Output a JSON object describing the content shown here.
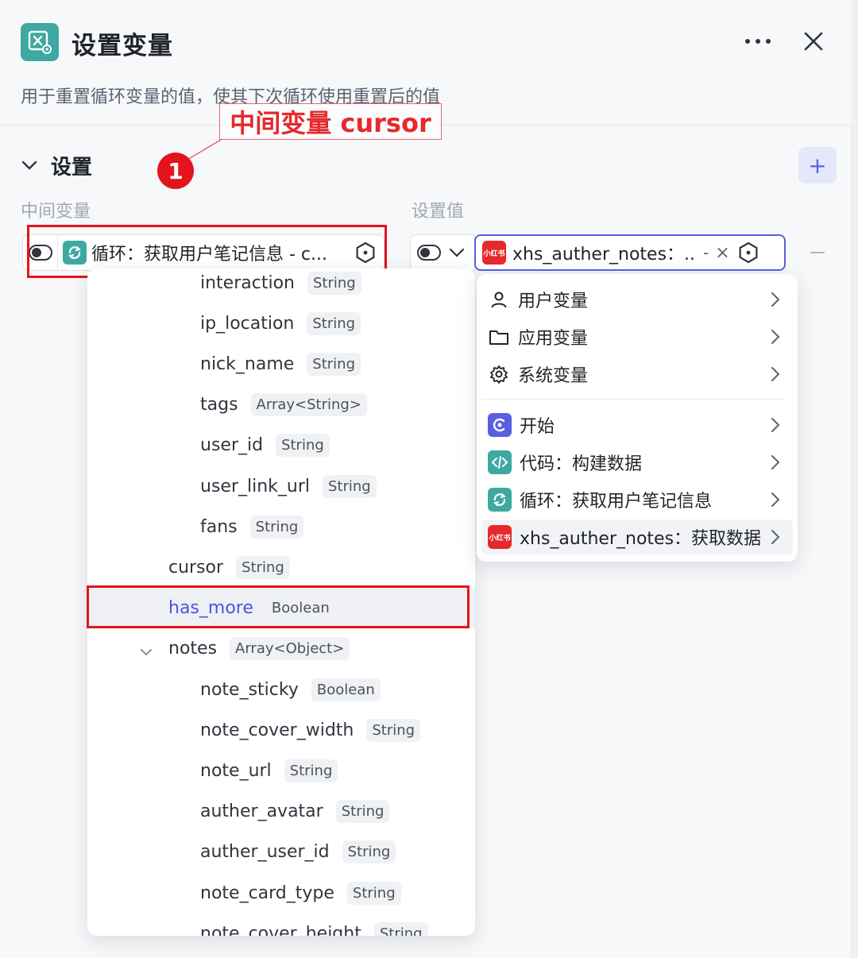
{
  "header": {
    "title": "设置变量",
    "description": "用于重置循环变量的值，使其下次循环使用重置后的值",
    "more_label": "···",
    "close_label": "✕"
  },
  "annotation": {
    "callout": "中间变量 cursor",
    "badge": "1"
  },
  "section": {
    "title": "设置",
    "add_label": "+"
  },
  "columns": {
    "intermediate": "中间变量",
    "set_value": "设置值"
  },
  "left_field": {
    "text": "循环：获取用户笔记信息 - c..."
  },
  "right_field": {
    "source_badge": "小红书",
    "text": "xhs_auther_notes：...",
    "dash": "-",
    "clear": "×"
  },
  "tree": {
    "rows": [
      {
        "name": "interaction",
        "type": "String",
        "indent": 2
      },
      {
        "name": "ip_location",
        "type": "String",
        "indent": 2
      },
      {
        "name": "nick_name",
        "type": "String",
        "indent": 2
      },
      {
        "name": "tags",
        "type": "Array<String>",
        "indent": 2
      },
      {
        "name": "user_id",
        "type": "String",
        "indent": 2
      },
      {
        "name": "user_link_url",
        "type": "String",
        "indent": 2
      },
      {
        "name": "fans",
        "type": "String",
        "indent": 2
      },
      {
        "name": "cursor",
        "type": "String",
        "indent": 1
      },
      {
        "name": "has_more",
        "type": "Boolean",
        "indent": 1,
        "selected": true
      },
      {
        "name": "notes",
        "type": "Array<Object>",
        "indent": 1,
        "expanded": true
      },
      {
        "name": "note_sticky",
        "type": "Boolean",
        "indent": 2
      },
      {
        "name": "note_cover_width",
        "type": "String",
        "indent": 2
      },
      {
        "name": "note_url",
        "type": "String",
        "indent": 2
      },
      {
        "name": "auther_avatar",
        "type": "String",
        "indent": 2
      },
      {
        "name": "auther_user_id",
        "type": "String",
        "indent": 2
      },
      {
        "name": "note_card_type",
        "type": "String",
        "indent": 2
      },
      {
        "name": "note_cover_height",
        "type": "String",
        "indent": 2
      }
    ]
  },
  "menu": {
    "group1": [
      {
        "label": "用户变量",
        "icon": "user-icon"
      },
      {
        "label": "应用变量",
        "icon": "folder-icon"
      },
      {
        "label": "系统变量",
        "icon": "gear-icon"
      }
    ],
    "group2": [
      {
        "label": "开始",
        "icon": "start-icon",
        "color": "#5a5fe0"
      },
      {
        "label": "代码：构建数据",
        "icon": "code-icon",
        "color": "#3ea9a0"
      },
      {
        "label": "循环：获取用户笔记信息",
        "icon": "loop-icon",
        "color": "#3ea9a0"
      },
      {
        "label": "xhs_auther_notes：获取数据",
        "icon": "xiaohongshu-icon",
        "color": "#e5292c",
        "badge": "小红书"
      }
    ]
  },
  "colors": {
    "accent": "#5a5fe0",
    "teal": "#3ea9a0",
    "annotation_red": "#e3141b"
  }
}
